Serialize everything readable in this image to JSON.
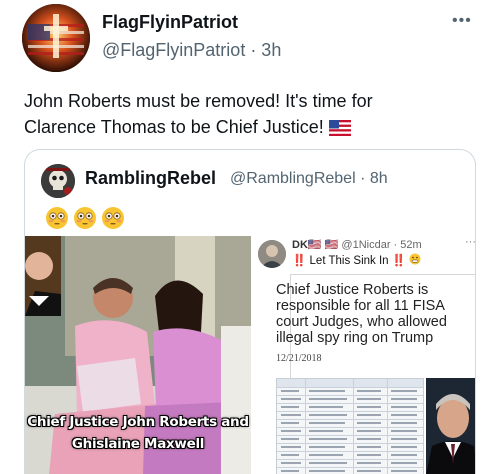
{
  "tweet": {
    "display_name": "FlagFlyinPatriot",
    "handle_time": "@FlagFlyinPatriot · 3h",
    "more": "•••",
    "text_line1": "John Roberts must be removed! It's time for",
    "text_line2": "Clarence Thomas to be Chief Justice!"
  },
  "quote": {
    "display_name": "RamblingRebel",
    "handle_time": "@RamblingRebel · 8h",
    "caption_line1": "Chief Justice John Roberts and",
    "caption_line2": "Ghislaine Maxwell",
    "inner": {
      "handle": "DK🇺🇸 🇺🇸",
      "handle_meta": "@1Nicdar · 52m",
      "more": "···",
      "text": "Let This Sink In",
      "headline": "Chief Justice Roberts is responsible for all 11 FISA court Judges, who allowed illegal spy ring on Trump",
      "date": "12/21/2018"
    }
  },
  "colors": {
    "text": "#0f1419",
    "muted": "#536471",
    "border": "#cfd9de"
  }
}
